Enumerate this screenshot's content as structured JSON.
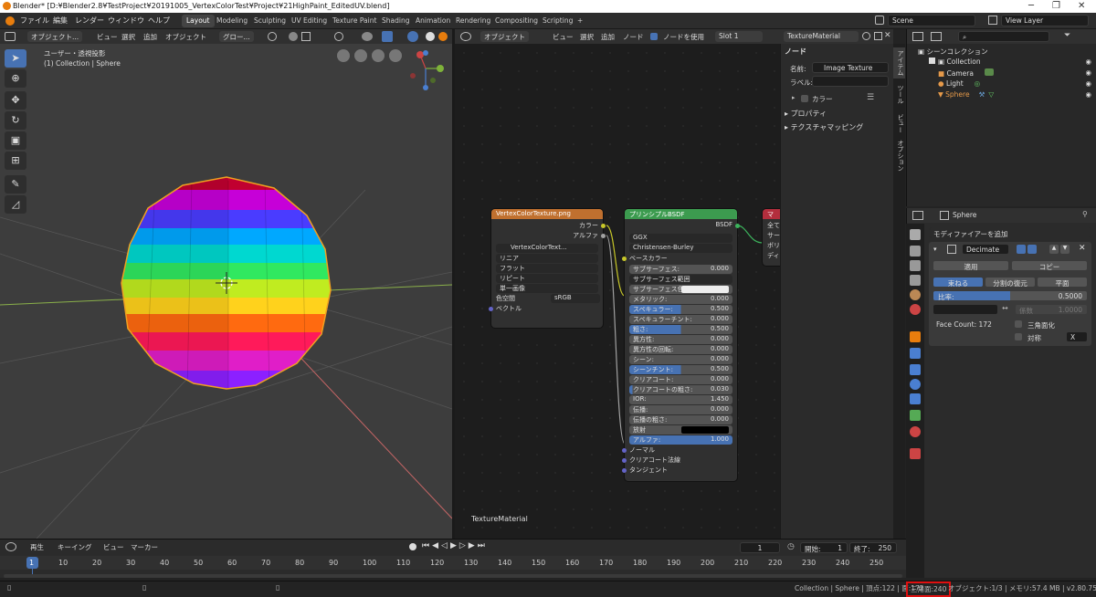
{
  "window": {
    "title": "Blender* [D:¥Blender2.8¥TestProject¥20191005_VertexColorTest¥Project¥21HighPaint_EditedUV.blend]",
    "controls": [
      "─",
      "❐",
      "✕"
    ]
  },
  "menu": [
    "ファイル",
    "編集",
    "レンダー",
    "ウィンドウ",
    "ヘルプ"
  ],
  "workspaces": {
    "active": "Layout",
    "tabs": [
      "Modeling",
      "Sculpting",
      "UV Editing",
      "Texture Paint",
      "Shading",
      "Animation",
      "Rendering",
      "Compositing",
      "Scripting",
      "+"
    ]
  },
  "scene": {
    "name": "Scene",
    "view_layer": "View Layer"
  },
  "viewport": {
    "header": {
      "mode": "オブジェクト...",
      "items": [
        "ビュー",
        "選択",
        "追加",
        "オブジェクト"
      ],
      "transform": "グロー..."
    },
    "info_view": "ユーザー・透視投影",
    "info_collection": "(1) Collection | Sphere"
  },
  "node_editor": {
    "header": {
      "mode": "オブジェクト",
      "items": [
        "ビュー",
        "選択",
        "追加",
        "ノード"
      ],
      "use_nodes": "ノードを使用",
      "slot": "Slot 1",
      "material": "TextureMaterial"
    },
    "material_label": "TextureMaterial",
    "tex_node": {
      "title": "VertexColorTexture.png",
      "out_color": "カラー",
      "out_alpha": "アルファ",
      "image": "VertexColorText...",
      "interp": "リニア",
      "proj": "フラット",
      "ext": "リピート",
      "source": "単一画像",
      "colorspace_label": "色空間",
      "colorspace": "sRGB",
      "vector": "ベクトル"
    },
    "bsdf_node": {
      "title": "プリンシプルBSDF",
      "out": "BSDF",
      "dist": "GGX",
      "sss": "Christensen-Burley",
      "base_color": "ベースカラー",
      "rows": [
        {
          "label": "サブサーフェス:",
          "value": "0.000",
          "fill": 0
        },
        {
          "label": "サブサーフェス範囲",
          "value": "",
          "fill": 0
        },
        {
          "label": "サブサーフェス色",
          "value": "",
          "fill": 0
        },
        {
          "label": "メタリック:",
          "value": "0.000",
          "fill": 0
        },
        {
          "label": "スペキュラー:",
          "value": "0.500",
          "fill": 0.5
        },
        {
          "label": "スペキュラーチント:",
          "value": "0.000",
          "fill": 0
        },
        {
          "label": "粗さ:",
          "value": "0.500",
          "fill": 0.5
        },
        {
          "label": "異方性:",
          "value": "0.000",
          "fill": 0
        },
        {
          "label": "異方性の回転:",
          "value": "0.000",
          "fill": 0
        },
        {
          "label": "シーン:",
          "value": "0.000",
          "fill": 0
        },
        {
          "label": "シーンチント:",
          "value": "0.500",
          "fill": 0.5
        },
        {
          "label": "クリアコート:",
          "value": "0.000",
          "fill": 0
        },
        {
          "label": "クリアコートの粗さ:",
          "value": "0.030",
          "fill": 0.03
        },
        {
          "label": "IOR:",
          "value": "1.450",
          "fill": 0
        },
        {
          "label": "伝播:",
          "value": "0.000",
          "fill": 0
        },
        {
          "label": "伝播の粗さ:",
          "value": "0.000",
          "fill": 0
        },
        {
          "label": "放射",
          "value": "",
          "fill": 0
        },
        {
          "label": "アルファ:",
          "value": "1.000",
          "fill": 1
        }
      ],
      "normal": "ノーマル",
      "clearcoat_normal": "クリアコート法線",
      "tangent": "タンジェント"
    },
    "out_node": {
      "title": "マ",
      "rows": [
        "全て",
        "サー",
        "ボリ",
        "ディ"
      ]
    }
  },
  "npanel": {
    "section": "ノード",
    "name_label": "名前:",
    "name_value": "Image Texture",
    "label_label": "ラベル:",
    "color_label": "カラー",
    "properties": "プロパティ",
    "texture_mapping": "テクスチャマッピング",
    "tabs": [
      "アイテム",
      "ツール",
      "ビュー",
      "オプション"
    ]
  },
  "outliner": {
    "root": "シーンコレクション",
    "collection": "Collection",
    "items": [
      {
        "name": "Camera",
        "color": "#e69a4a"
      },
      {
        "name": "Light",
        "color": "#e69a4a"
      },
      {
        "name": "Sphere",
        "color": "#e69a4a"
      }
    ]
  },
  "properties": {
    "object": "Sphere",
    "add_modifier": "モディファイアーを追加",
    "modifier_name": "Decimate",
    "apply": "適用",
    "copy": "コピー",
    "modes": [
      "束ねる",
      "分割の復元",
      "平面"
    ],
    "ratio_label": "比率:",
    "ratio_value": "0.5000",
    "ratio_fill": 0.5,
    "factor_label": "係数",
    "factor_value": "1.0000",
    "face_count": "Face Count: 172",
    "triangulate": "三角面化",
    "symmetry": "対称",
    "axis": "X"
  },
  "timeline": {
    "menu": [
      "再生",
      "キーイング",
      "ビュー",
      "マーカー"
    ],
    "current_frame": "1",
    "start_label": "開始:",
    "start": "1",
    "end_label": "終了:",
    "end": "250",
    "ticks": [
      "1",
      "10",
      "20",
      "30",
      "40",
      "50",
      "60",
      "70",
      "80",
      "90",
      "100",
      "110",
      "120",
      "130",
      "140",
      "150",
      "160",
      "170",
      "180",
      "190",
      "200",
      "210",
      "220",
      "230",
      "240",
      "250"
    ]
  },
  "status": {
    "left": "Collection | Sphere | 頂点:122 | 面:172",
    "triangles": "三角面:240",
    "right": "オブジェクト:1/3 | メモリ:57.4 MB | v2.80.75"
  }
}
